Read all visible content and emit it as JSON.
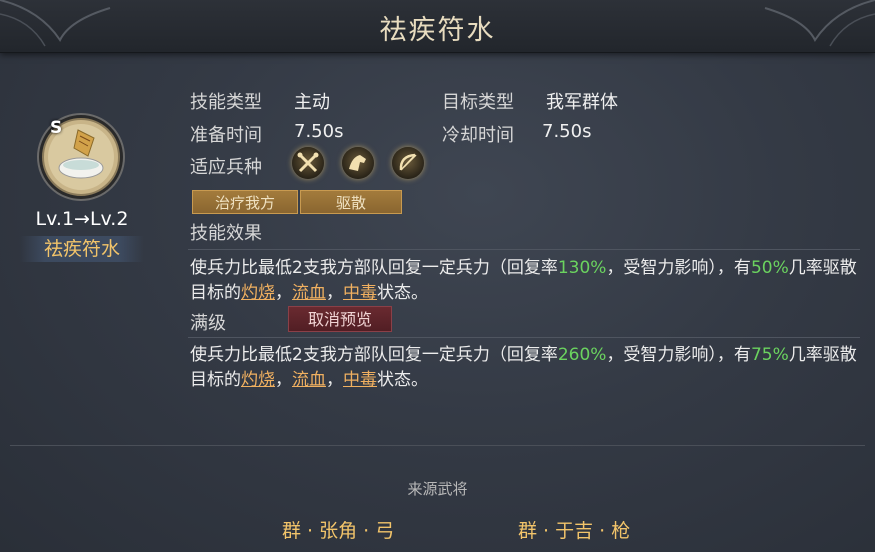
{
  "header": {
    "title": "祛疾符水"
  },
  "skill": {
    "level_text": "Lv.1→Lv.2",
    "name": "祛疾符水",
    "icon_letter": "S"
  },
  "info": {
    "skill_type_label": "技能类型",
    "skill_type_value": "主动",
    "target_type_label": "目标类型",
    "target_type_value": "我军群体",
    "prepare_label": "准备时间",
    "prepare_value": "7.50s",
    "cooldown_label": "冷却时间",
    "cooldown_value": "7.50s",
    "troop_label": "适应兵种",
    "troops": [
      "spear-troop-icon",
      "cavalry-troop-icon",
      "archer-troop-icon"
    ],
    "tags": [
      "治疗我方",
      "驱散"
    ]
  },
  "effect": {
    "label": "技能效果",
    "p1": "使兵力比最低2支我方部队回复一定兵力（回复率",
    "rate": "130%",
    "p2": "，受智力影响），有",
    "chance": "50%",
    "p3": "几率驱散目标的",
    "kw1": "灼烧",
    "sep1": "，",
    "kw2": "流血",
    "sep2": "，",
    "kw3": "中毒",
    "p4": "状态。"
  },
  "max_level": {
    "label": "满级",
    "cancel_label": "取消预览",
    "p1": "使兵力比最低2支我方部队回复一定兵力（回复率",
    "rate": "260%",
    "p2": "，受智力影响），有",
    "chance": "75%",
    "p3": "几率驱散目标的",
    "kw1": "灼烧",
    "sep1": "，",
    "kw2": "流血",
    "sep2": "，",
    "kw3": "中毒",
    "p4": "状态。"
  },
  "source": {
    "title": "来源武将",
    "generals": [
      "群 · 张角 · 弓",
      "群 · 于吉 · 枪"
    ]
  },
  "colors": {
    "accent_gold": "#f2c46a",
    "green": "#6bd35f",
    "orange": "#f0b060"
  }
}
